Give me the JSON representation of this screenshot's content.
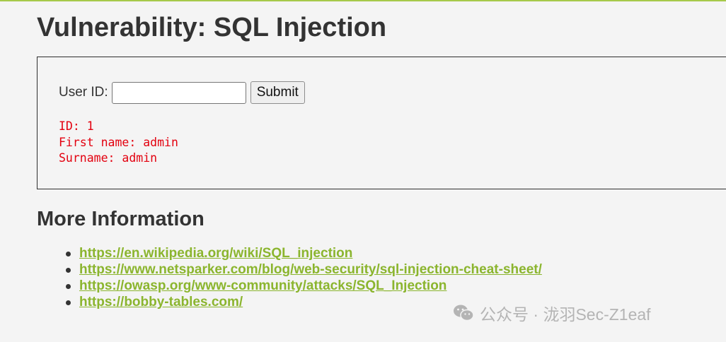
{
  "page": {
    "title": "Vulnerability: SQL Injection"
  },
  "form": {
    "user_id_label": "User ID:",
    "user_id_value": "",
    "user_id_placeholder": "",
    "submit_label": "Submit"
  },
  "result": {
    "id_line": "ID: 1",
    "first_name_line": "First name: admin",
    "surname_line": "Surname: admin"
  },
  "more_info": {
    "heading": "More Information",
    "links": [
      "https://en.wikipedia.org/wiki/SQL_injection",
      "https://www.netsparker.com/blog/web-security/sql-injection-cheat-sheet/",
      "https://owasp.org/www-community/attacks/SQL_Injection",
      "https://bobby-tables.com/"
    ]
  },
  "watermark": {
    "icon": "wechat-icon",
    "text": "公众号 · 泷羽Sec-Z1eaf"
  },
  "colors": {
    "accent_green": "#8bb52e",
    "top_rule": "#a6c94a",
    "result_red": "#e3000f",
    "background": "#f4f4f4"
  }
}
